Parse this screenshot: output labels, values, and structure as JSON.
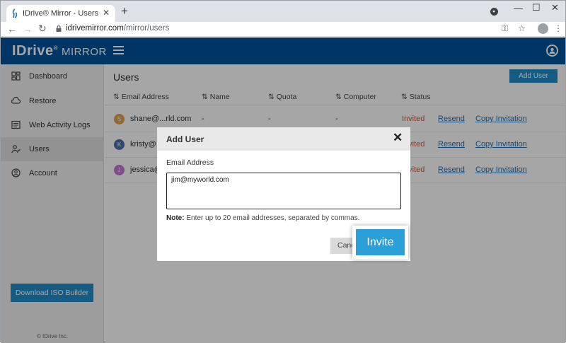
{
  "browser": {
    "tab_title": "IDrive® Mirror - Users",
    "tab_close": "✕",
    "new_tab": "+",
    "url_host": "idrivemirror.com",
    "url_path": "/mirror/users"
  },
  "app": {
    "logo": "IDrive",
    "logo_mark": "®",
    "product": "MIRROR"
  },
  "sidebar": {
    "items": [
      {
        "label": "Dashboard",
        "icon": "dashboard-icon"
      },
      {
        "label": "Restore",
        "icon": "cloud-icon"
      },
      {
        "label": "Web Activity Logs",
        "icon": "logs-icon"
      },
      {
        "label": "Users",
        "icon": "users-icon"
      },
      {
        "label": "Account",
        "icon": "account-icon"
      }
    ],
    "active_index": 3,
    "download_button": "Download ISO Builder",
    "footer": "© IDrive Inc."
  },
  "main": {
    "title": "Users",
    "add_user_button": "Add User",
    "columns": [
      "Email Address",
      "Name",
      "Quota",
      "Computer",
      "Status"
    ],
    "sort_glyph": "⇅",
    "rows": [
      {
        "initial": "S",
        "color": "#e0a050",
        "email": "shane@...rld.com",
        "name": "-",
        "quota": "-",
        "computer": "-",
        "status": "Invited",
        "resend": "Resend",
        "copy": "Copy Invitation"
      },
      {
        "initial": "K",
        "color": "#4a6fa8",
        "email": "kristy@...",
        "name": "",
        "quota": "",
        "computer": "",
        "status": "Invited",
        "resend": "Resend",
        "copy": "Copy Invitation"
      },
      {
        "initial": "J",
        "color": "#c07ad0",
        "email": "jessica@...",
        "name": "",
        "quota": "",
        "computer": "",
        "status": "Invited",
        "resend": "Resend",
        "copy": "Copy Invitation"
      }
    ]
  },
  "modal": {
    "title": "Add User",
    "close": "✕",
    "field_label": "Email Address",
    "field_value": "jim@myworld.com",
    "note_bold": "Note:",
    "note_text": " Enter up to 20 email addresses, separated by commas.",
    "cancel_button": "Cancel",
    "invite_button": "Invite"
  },
  "colors": {
    "header": "#00539b",
    "accent": "#1f8ec9",
    "invited": "#e0533d"
  }
}
